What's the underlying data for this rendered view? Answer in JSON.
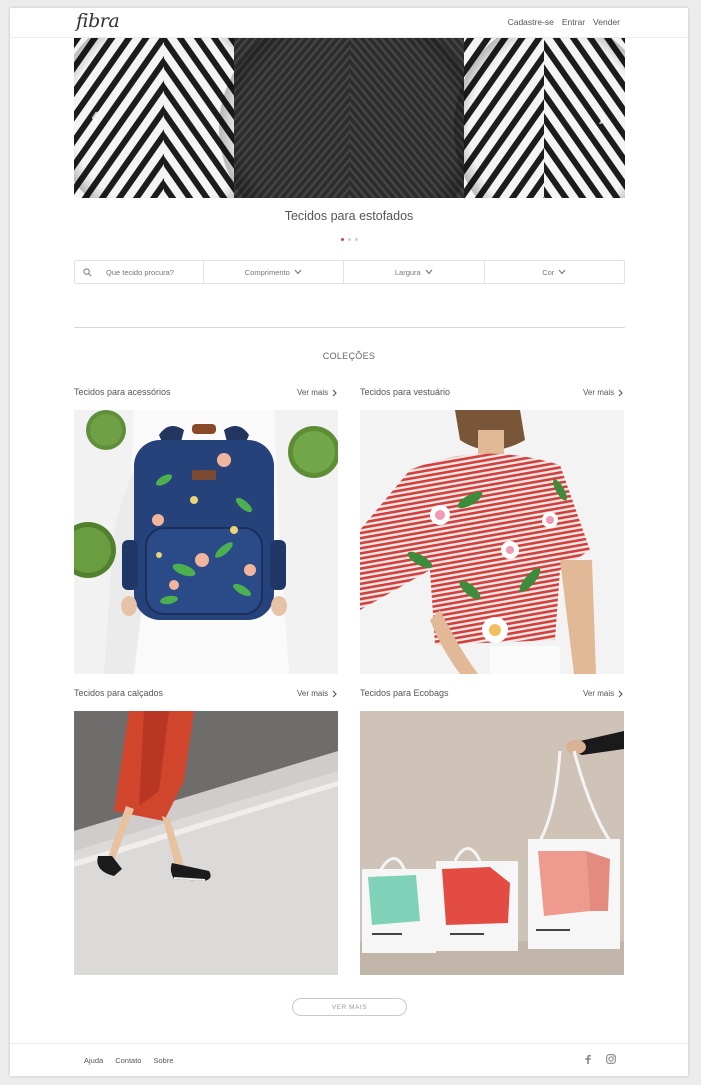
{
  "header": {
    "logo": "fibra",
    "nav": [
      "Cadastre-se",
      "Entrar",
      "Vender"
    ]
  },
  "hero": {
    "title": "Tecidos para estofados",
    "slides": 3,
    "active_slide": 1,
    "prev_icon": "chevron-left-icon",
    "next_icon": "chevron-right-icon"
  },
  "search": {
    "placeholder": "Que tecido procura?",
    "filters": [
      "Comprimento",
      "Largura",
      "Cor"
    ],
    "icon": "search-icon"
  },
  "collections": {
    "title": "COLEÇÕES",
    "more_label": "Ver mais",
    "items": [
      {
        "title": "Tecidos para acessórios"
      },
      {
        "title": "Tecidos para vestuário"
      },
      {
        "title": "Tecidos para calçados"
      },
      {
        "title": "Tecidos para Ecobags"
      }
    ]
  },
  "load_more": "VER MAIS",
  "footer": {
    "links": [
      "Ajuda",
      "Contato",
      "Sobre"
    ],
    "social_icons": [
      "facebook-icon",
      "instagram-icon"
    ]
  },
  "colors": {
    "accent": "#e43b3b",
    "border": "#e2e2e2",
    "text": "#555555"
  }
}
